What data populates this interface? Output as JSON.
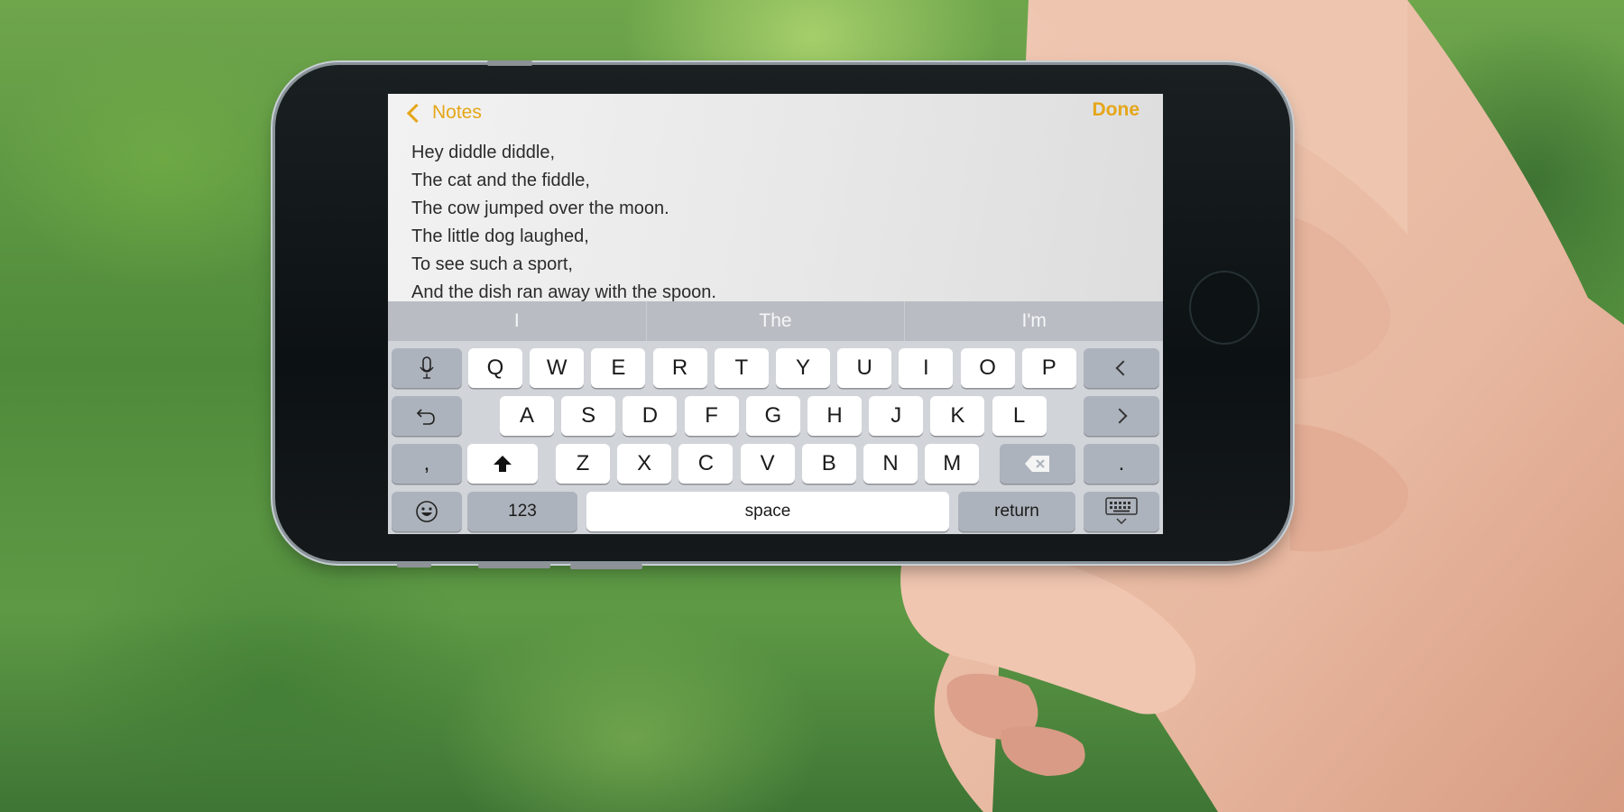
{
  "app": {
    "name": "Notes",
    "accent_color": "#e5a618"
  },
  "nav": {
    "back_label": "Notes",
    "back_icon": "chevron-left-icon",
    "done_label": "Done"
  },
  "note": {
    "lines": [
      "Hey diddle diddle,",
      "The cat and the fiddle,",
      "The cow jumped over the moon.",
      "The little dog laughed,",
      "To see such a sport,",
      "And the dish ran away with the spoon."
    ]
  },
  "suggestions": [
    "I",
    "The",
    "I'm"
  ],
  "keyboard": {
    "row1": [
      "Q",
      "W",
      "E",
      "R",
      "T",
      "Y",
      "U",
      "I",
      "O",
      "P"
    ],
    "row2": [
      "A",
      "S",
      "D",
      "F",
      "G",
      "H",
      "J",
      "K",
      "L"
    ],
    "row3": [
      "Z",
      "X",
      "C",
      "V",
      "B",
      "N",
      "M"
    ],
    "comma": ",",
    "period": ".",
    "numbers_label": "123",
    "space_label": "space",
    "return_label": "return",
    "icons": {
      "dictation": "microphone-icon",
      "undo": "undo-icon",
      "cursor_left": "chevron-left-icon",
      "cursor_right": "chevron-right-icon",
      "shift": "shift-arrow-icon",
      "delete": "backspace-icon",
      "emoji": "emoji-icon",
      "dismiss": "keyboard-dismiss-icon"
    }
  }
}
